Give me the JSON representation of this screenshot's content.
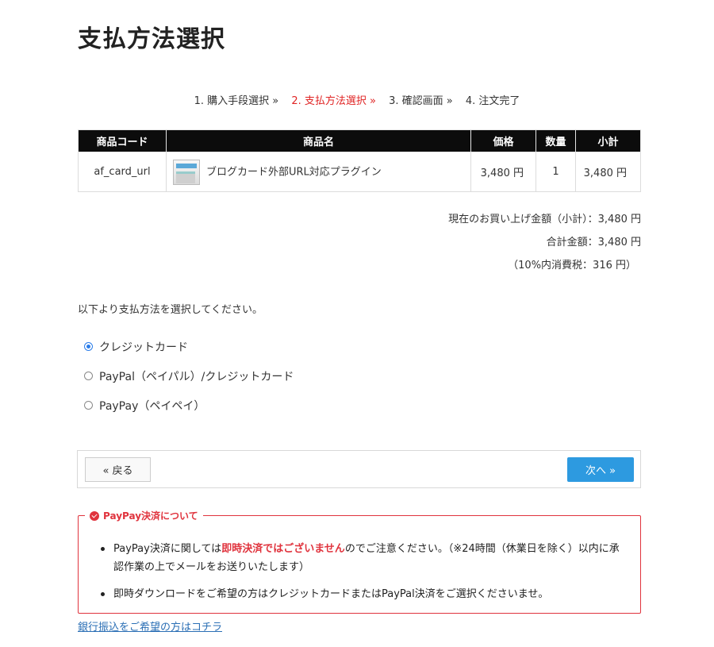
{
  "page": {
    "title": "支払方法選択"
  },
  "steps": [
    {
      "label": "1. 購入手段選択 »",
      "current": false
    },
    {
      "label": "2. 支払方法選択 »",
      "current": true
    },
    {
      "label": "3. 確認画面 »",
      "current": false
    },
    {
      "label": "4. 注文完了",
      "current": false
    }
  ],
  "cart": {
    "headers": {
      "code": "商品コード",
      "name": "商品名",
      "price": "価格",
      "qty": "数量",
      "subtotal": "小計"
    },
    "rows": [
      {
        "code": "af_card_url",
        "name": "ブログカード外部URL対応プラグイン",
        "price": "3,480 円",
        "qty": "1",
        "subtotal": "3,480 円"
      }
    ]
  },
  "totals": {
    "subtotal": "現在のお買い上げ金額（小計）：3,480 円",
    "total": "合計金額：3,480 円",
    "tax": "（10%内消費税：316 円）"
  },
  "instruction": "以下より支払方法を選択してください。",
  "payment_methods": [
    {
      "label": "クレジットカード",
      "selected": true
    },
    {
      "label": "PayPal（ペイパル）/クレジットカード",
      "selected": false
    },
    {
      "label": "PayPay（ペイペイ）",
      "selected": false
    }
  ],
  "nav": {
    "back_label": "« 戻る",
    "next_label": "次へ »"
  },
  "notice": {
    "title": "PayPay決済について",
    "item1_prefix": "PayPay決済に関しては",
    "item1_emphasis": "即時決済ではございません",
    "item1_suffix": "のでご注意ください。（※24時間（休業日を除く）以内に承認作業の上でメールをお送りいたします）",
    "item2": "即時ダウンロードをご希望の方はクレジットカードまたはPayPal決済をご選択くださいませ。"
  },
  "bank_link": "銀行振込をご希望の方はコチラ",
  "colors": {
    "accent_red": "#e02424",
    "button_blue": "#2d9ae0",
    "header_black": "#0c0c0c",
    "link_blue": "#2b6fb5"
  }
}
